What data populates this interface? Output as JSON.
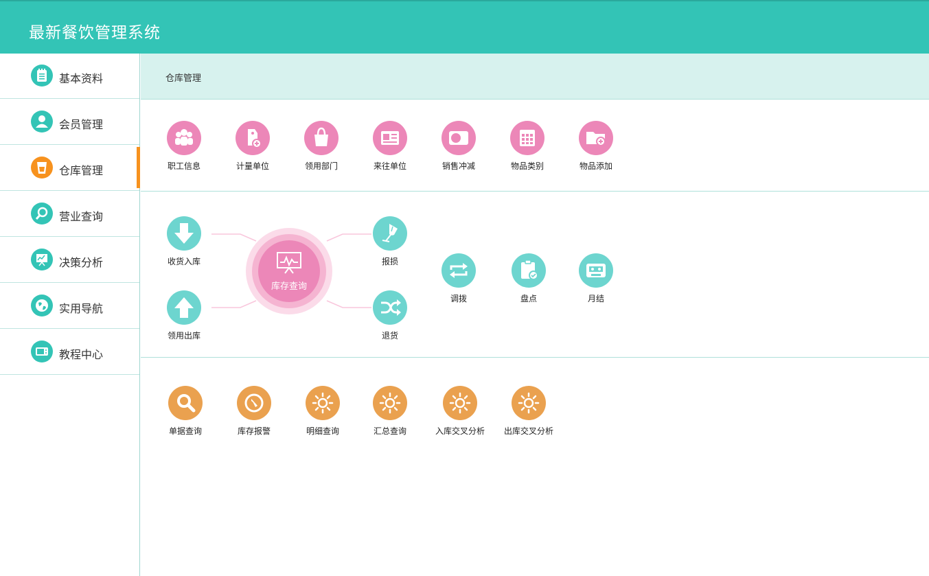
{
  "app": {
    "title": "最新餐饮管理系统"
  },
  "sidebar": {
    "items": [
      {
        "label": "基本资料",
        "icon": "notepad-icon",
        "active": false
      },
      {
        "label": "会员管理",
        "icon": "user-icon",
        "active": false
      },
      {
        "label": "仓库管理",
        "icon": "cup-icon",
        "active": true
      },
      {
        "label": "营业查询",
        "icon": "magnifier-icon",
        "active": false
      },
      {
        "label": "决策分析",
        "icon": "presentation-chart-icon",
        "active": false
      },
      {
        "label": "实用导航",
        "icon": "globe-icon",
        "active": false
      },
      {
        "label": "教程中心",
        "icon": "video-icon",
        "active": false
      }
    ]
  },
  "breadcrumb": "仓库管理",
  "sections": {
    "basic": [
      {
        "label": "职工信息",
        "icon": "staff-group-icon"
      },
      {
        "label": "计量单位",
        "icon": "tag-add-icon"
      },
      {
        "label": "领用部门",
        "icon": "shopping-bag-icon"
      },
      {
        "label": "来往单位",
        "icon": "id-card-icon"
      },
      {
        "label": "销售冲减",
        "icon": "toggle-card-icon"
      },
      {
        "label": "物品类别",
        "icon": "calendar-grid-icon"
      },
      {
        "label": "物品添加",
        "icon": "folder-add-icon"
      }
    ],
    "flow": {
      "hub": {
        "label": "库存查询",
        "icon": "monitor-chart-icon"
      },
      "left": [
        {
          "label": "收货入库",
          "icon": "arrow-down-icon"
        },
        {
          "label": "领用出库",
          "icon": "arrow-up-icon"
        }
      ],
      "right": [
        {
          "label": "报损",
          "icon": "broken-glass-icon"
        },
        {
          "label": "退货",
          "icon": "shuffle-icon"
        }
      ],
      "extra": [
        {
          "label": "调拨",
          "icon": "transfer-arrows-icon"
        },
        {
          "label": "盘点",
          "icon": "clipboard-check-icon"
        },
        {
          "label": "月结",
          "icon": "cassette-icon"
        }
      ]
    },
    "reports": [
      {
        "label": "单据查询",
        "icon": "search-icon"
      },
      {
        "label": "库存报警",
        "icon": "compass-icon"
      },
      {
        "label": "明细查询",
        "icon": "sun-icon"
      },
      {
        "label": "汇总查询",
        "icon": "sun-icon"
      },
      {
        "label": "入库交叉分析",
        "icon": "sun-icon"
      },
      {
        "label": "出库交叉分析",
        "icon": "sun-icon"
      }
    ]
  },
  "colors": {
    "header": "#33c4b6",
    "pink": "#ec87b8",
    "teal": "#6dd5cf",
    "orange": "#eaa14f",
    "active": "#f7921e"
  }
}
